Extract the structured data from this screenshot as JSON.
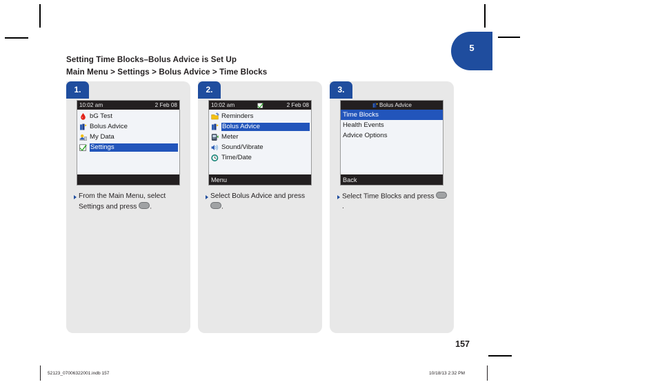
{
  "page": {
    "chapter_tab": "5",
    "page_number": "157",
    "footer_left": "52123_07006322001.indb   157",
    "footer_right": "10/18/13   2:32 PM",
    "accent_blue": "#1f4d9e",
    "highlight_blue": "#2255bb",
    "card_bg": "#e8e8e8"
  },
  "header": {
    "title": "Setting Time Blocks–Bolus Advice is Set Up",
    "breadcrumb": "Main Menu > Settings > Bolus Advice > Time Blocks"
  },
  "steps": [
    {
      "badge": "1.",
      "screen": {
        "titlebar": {
          "left": "10:02 am",
          "center_icon": "",
          "right": "2 Feb 08",
          "center_title": ""
        },
        "items": [
          {
            "label": "bG Test",
            "icon": "blood-drop-icon",
            "selected": false
          },
          {
            "label": "Bolus Advice",
            "icon": "bolus-advice-icon",
            "selected": false
          },
          {
            "label": "My Data",
            "icon": "my-data-icon",
            "selected": false
          },
          {
            "label": "Settings",
            "icon": "settings-icon",
            "selected": true
          }
        ],
        "softkey": ""
      },
      "caption_parts": {
        "before": "From the Main Menu, select Settings and press ",
        "after": "."
      }
    },
    {
      "badge": "2.",
      "screen": {
        "titlebar": {
          "left": "10:02 am",
          "center_icon": "settings-icon",
          "right": "2 Feb 08",
          "center_title": ""
        },
        "items": [
          {
            "label": "Reminders",
            "icon": "reminders-icon",
            "selected": false
          },
          {
            "label": "Bolus Advice",
            "icon": "bolus-advice-icon",
            "selected": true
          },
          {
            "label": "Meter",
            "icon": "meter-icon",
            "selected": false
          },
          {
            "label": "Sound/Vibrate",
            "icon": "sound-icon",
            "selected": false
          },
          {
            "label": "Time/Date",
            "icon": "clock-icon",
            "selected": false
          }
        ],
        "softkey": "Menu"
      },
      "caption_parts": {
        "before": "Select Bolus Advice and press ",
        "after": "."
      }
    },
    {
      "badge": "3.",
      "screen": {
        "titlebar": {
          "left": "",
          "center_icon": "bolus-advice-icon",
          "right": "",
          "center_title": "Bolus Advice"
        },
        "items": [
          {
            "label": "Time Blocks",
            "icon": "",
            "selected": true
          },
          {
            "label": "Health Events",
            "icon": "",
            "selected": false
          },
          {
            "label": "Advice Options",
            "icon": "",
            "selected": false
          }
        ],
        "softkey": "Back"
      },
      "caption_parts": {
        "before": "Select Time Blocks and press ",
        "after": "."
      }
    }
  ]
}
